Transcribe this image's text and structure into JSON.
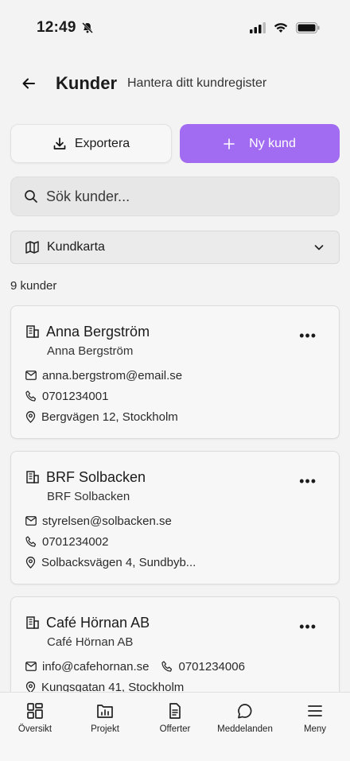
{
  "status": {
    "time": "12:49"
  },
  "header": {
    "title": "Kunder",
    "subtitle": "Hantera ditt kundregister"
  },
  "actions": {
    "export_label": "Exportera",
    "new_label": "Ny kund"
  },
  "search": {
    "placeholder": "Sök kunder..."
  },
  "map_select": {
    "label": "Kundkarta"
  },
  "count_label": "9 kunder",
  "customers": [
    {
      "name": "Anna Bergström",
      "contact": "Anna Bergström",
      "email": "anna.bergstrom@email.se",
      "phone": "0701234001",
      "address": "Bergvägen 12, Stockholm"
    },
    {
      "name": "BRF Solbacken",
      "contact": "BRF Solbacken",
      "email": "styrelsen@solbacken.se",
      "phone": "0701234002",
      "address": "Solbacksvägen 4, Sundbyb..."
    },
    {
      "name": "Café Hörnan AB",
      "contact": "Café Hörnan AB",
      "email": "info@cafehornan.se",
      "phone": "0701234006",
      "address": "Kungsgatan 41, Stockholm"
    }
  ],
  "nav": [
    {
      "label": "Översikt",
      "icon": "grid-icon"
    },
    {
      "label": "Projekt",
      "icon": "chart-icon"
    },
    {
      "label": "Offerter",
      "icon": "document-icon"
    },
    {
      "label": "Meddelanden",
      "icon": "chat-icon"
    },
    {
      "label": "Meny",
      "icon": "menu-icon"
    }
  ],
  "colors": {
    "accent": "#a26cf2",
    "background": "#f3f3f3"
  }
}
